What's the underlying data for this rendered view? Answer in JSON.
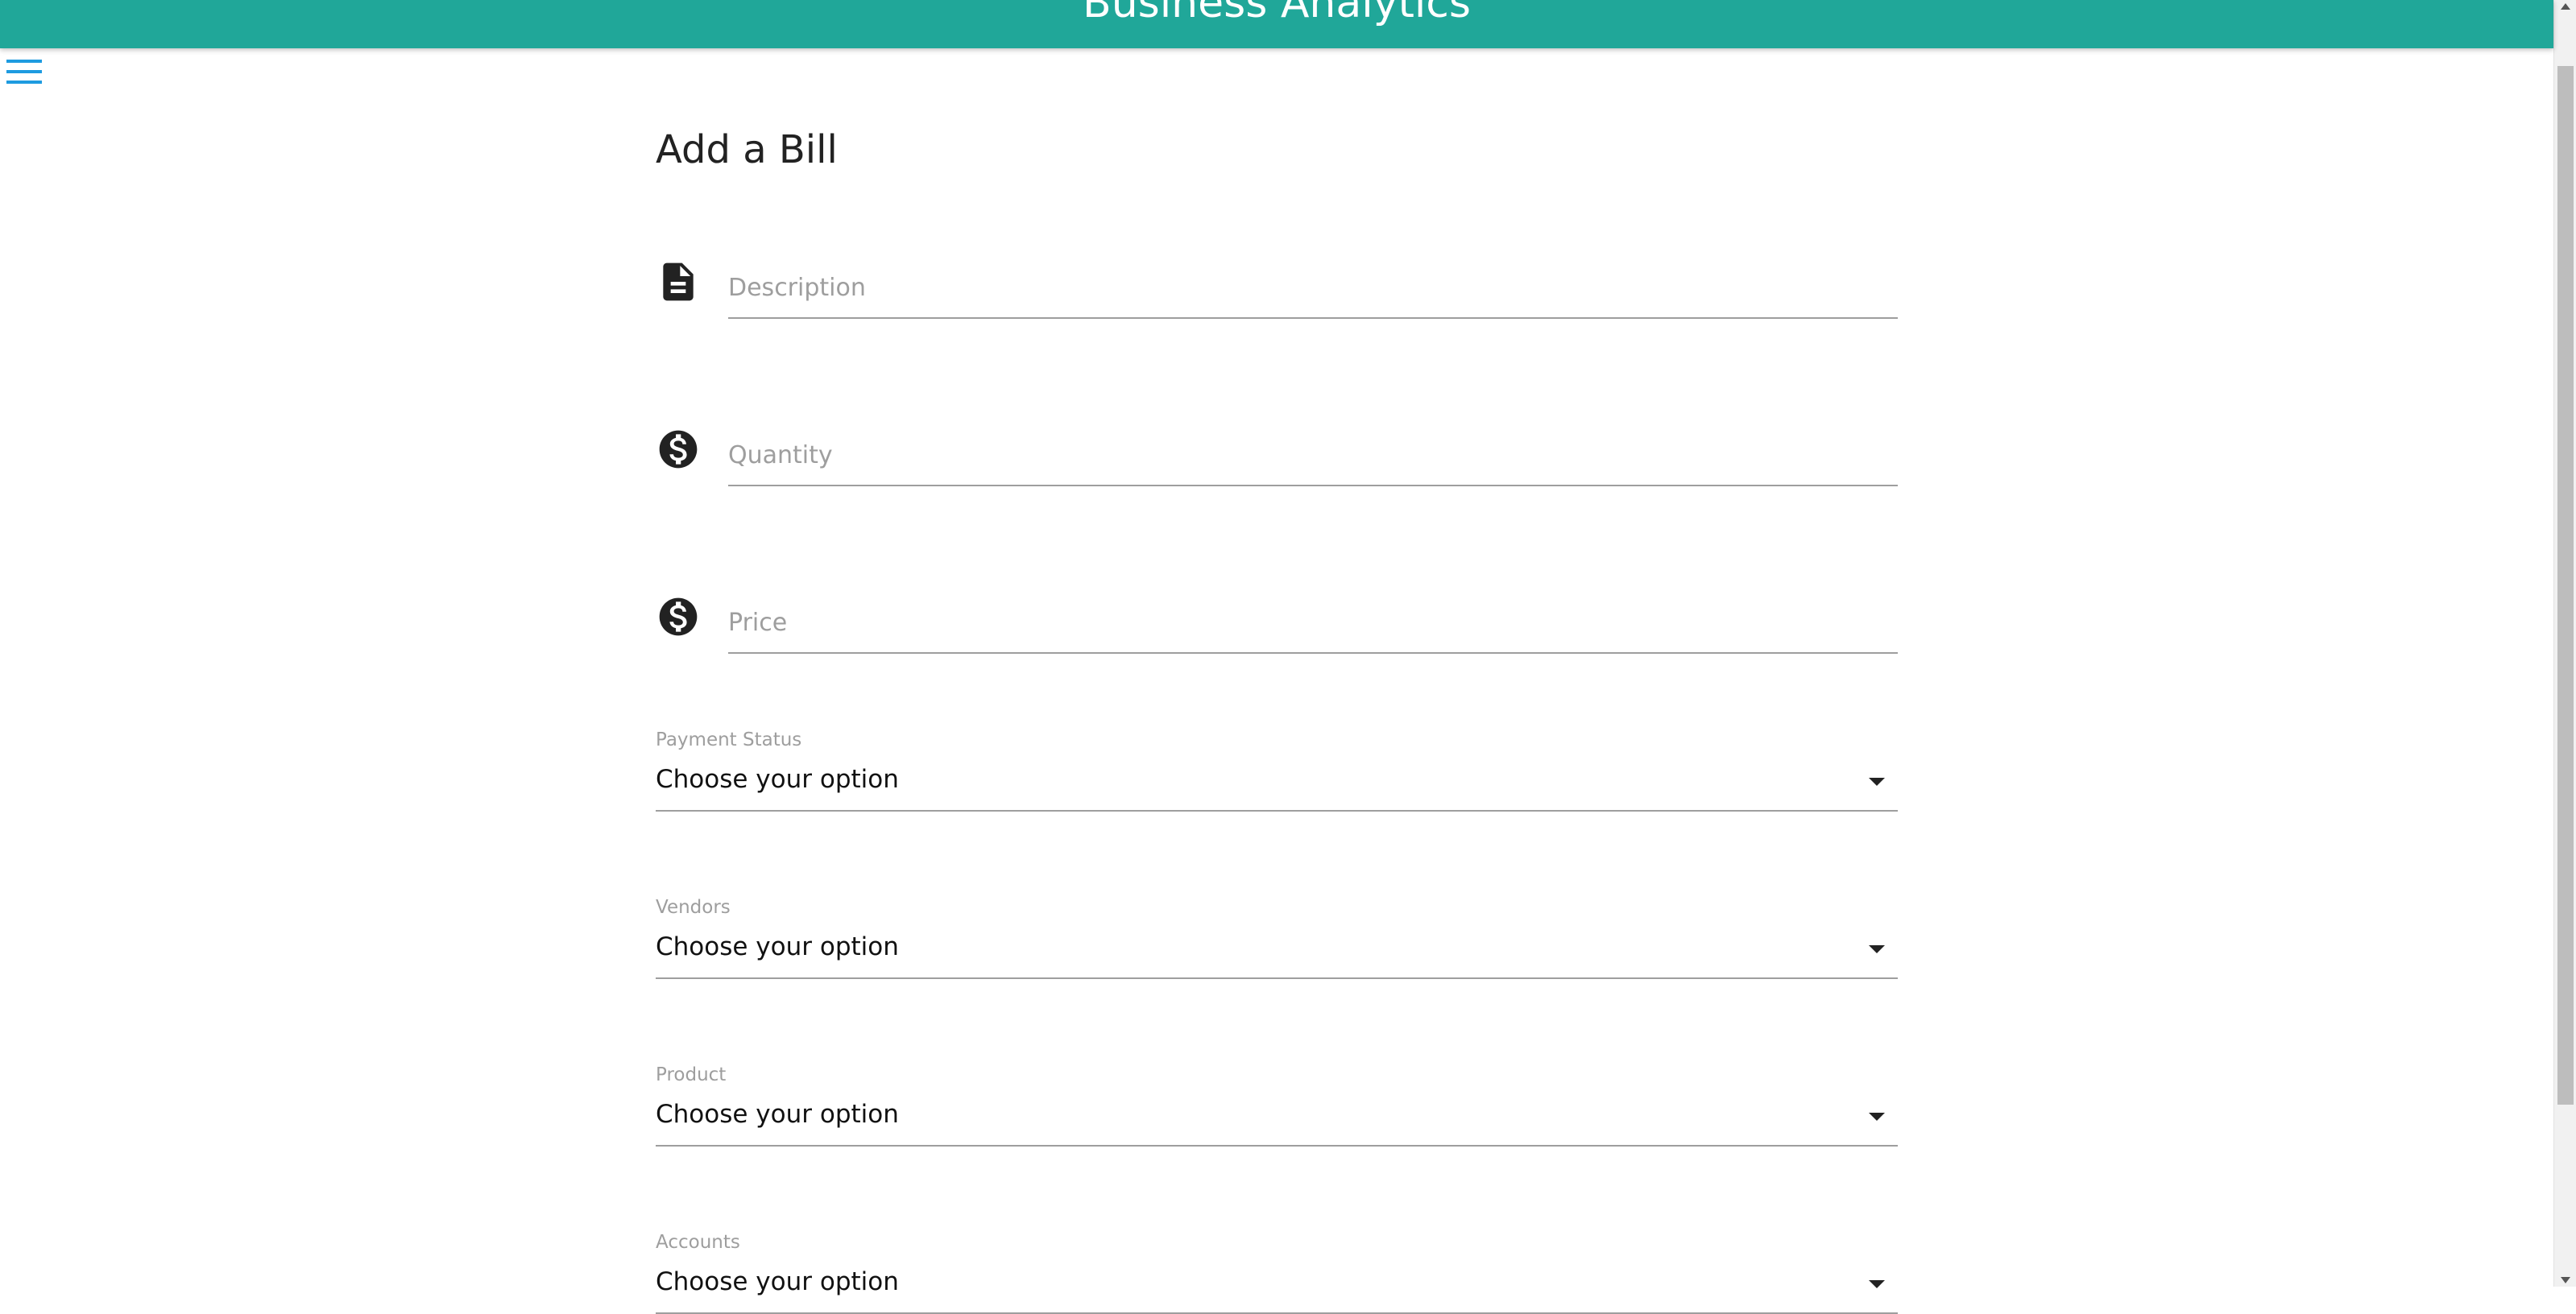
{
  "header": {
    "title": "Business Analytics",
    "bg_color": "#20a799"
  },
  "nav": {
    "menu_icon": "hamburger-menu-icon",
    "menu_icon_color": "#1e9be0"
  },
  "form": {
    "title": "Add a Bill",
    "inputs": [
      {
        "icon": "document-icon",
        "placeholder": "Description",
        "value": ""
      },
      {
        "icon": "dollar-circle-icon",
        "placeholder": "Quantity",
        "value": ""
      },
      {
        "icon": "dollar-circle-icon",
        "placeholder": "Price",
        "value": ""
      }
    ],
    "selects": [
      {
        "label": "Payment Status",
        "value": "Choose your option"
      },
      {
        "label": "Vendors",
        "value": "Choose your option"
      },
      {
        "label": "Product",
        "value": "Choose your option"
      },
      {
        "label": "Accounts",
        "value": "Choose your option"
      }
    ]
  }
}
